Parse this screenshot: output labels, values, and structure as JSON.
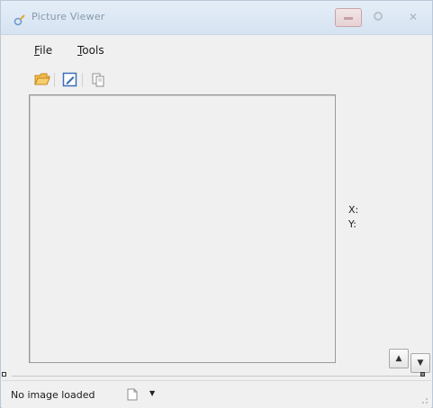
{
  "window": {
    "title": "Picture Viewer",
    "icon": "picture-viewer-app-icon"
  },
  "controls": {
    "minimize": "minimize-icon",
    "maximize": "maximize-icon",
    "close": "close-icon"
  },
  "menu": {
    "file_key": "F",
    "file_rest": "ile",
    "tools_key": "T",
    "tools_rest": "ools"
  },
  "toolbar": {
    "icons": [
      "open-folder-icon",
      "edit-image-icon",
      "copy-icon"
    ]
  },
  "coordinates": {
    "x_label": "X:",
    "y_label": "Y:"
  },
  "zoom": {
    "up_glyph": "▲",
    "down_glyph": "▼"
  },
  "status": {
    "text": "No image loaded",
    "dropdown_glyph": "▼"
  },
  "colors": {
    "title_text": "#8799a9",
    "window_bg": "#f0f0f0",
    "folder": "#f2b84b",
    "edit_blue": "#3b6fb6"
  }
}
